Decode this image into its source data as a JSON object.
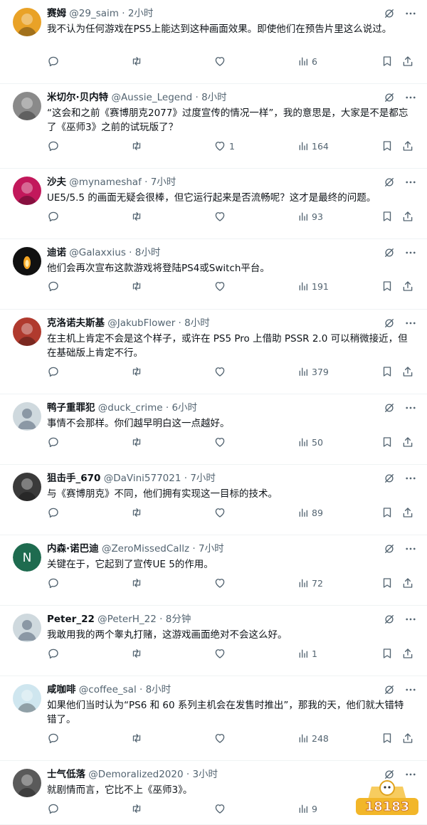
{
  "tweets": [
    {
      "name": "赛姆",
      "handle": "@29_saim",
      "time": "2小时",
      "text": "我不认为任何游戏在PS5上能达到这种画面效果。即使他们在预告片里这么说过。",
      "likes": "",
      "views": "6",
      "avatar_color": "#e9a227"
    },
    {
      "name": "米切尔·贝内特",
      "handle": "@Aussie_Legend",
      "time": "8小时",
      "text": "“这会和之前《赛博朋克2077》过度宣传的情况一样”，我的意思是，大家是不是都忘了《巫师3》之前的试玩版了？",
      "likes": "1",
      "views": "164",
      "avatar_color": "#8a8a8a"
    },
    {
      "name": "沙夫",
      "handle": "@mynameshaf",
      "time": "7小时",
      "text": "UE5/5.5 的画面无疑会很棒，但它运行起来是否流畅呢？这才是最终的问题。",
      "likes": "",
      "views": "93",
      "avatar_color": "#c2185b"
    },
    {
      "name": "迪诺",
      "handle": "@Galaxxius",
      "time": "8小时",
      "text": "他们会再次宣布这款游戏将登陆PS4或Switch平台。",
      "likes": "",
      "views": "191",
      "avatar_color": "#1a1a1a"
    },
    {
      "name": "克洛诺夫斯基",
      "handle": "@JakubFlower",
      "time": "8小时",
      "text": "在主机上肯定不会是这个样子，或许在 PS5 Pro 上借助 PSSR 2.0 可以稍微接近，但在基础版上肯定不行。",
      "likes": "",
      "views": "379",
      "avatar_color": "#b03a2e"
    },
    {
      "name": "鸭子重罪犯",
      "handle": "@duck_crime",
      "time": "6小时",
      "text": "事情不会那样。你们越早明白这一点越好。",
      "likes": "",
      "views": "50",
      "avatar_color": "#c4cfd6"
    },
    {
      "name": "狙击手_670",
      "handle": "@DaVini577021",
      "time": "7小时",
      "text": "与《赛博朋克》不同，他们拥有实现这一目标的技术。",
      "likes": "",
      "views": "89",
      "avatar_color": "#3a3a3a"
    },
    {
      "name": "内森·诺巴迪",
      "handle": "@ZeroMissedCallz",
      "time": "7小时",
      "text": "关键在于，它起到了宣传UE 5的作用。",
      "likes": "",
      "views": "72",
      "avatar_color": "#1e6b4f",
      "avatar_letter": "N"
    },
    {
      "name": "Peter_22",
      "handle": "@PeterH_22",
      "time": "8分钟",
      "text": "我敢用我的两个睾丸打赌，这游戏画面绝对不会这么好。",
      "likes": "",
      "views": "1",
      "avatar_color": "#c4cfd6"
    },
    {
      "name": "咸咖啡",
      "handle": "@coffee_sal",
      "time": "8小时",
      "text": "如果他们当时认为“PS6 和 60 系列主机会在发售时推出”，那我的天，他们就大错特错了。",
      "likes": "",
      "views": "248",
      "avatar_color": "#cfe6ef"
    },
    {
      "name": "士气低落",
      "handle": "@Demoralized2020",
      "time": "3小时",
      "text": "就剧情而言，它比不上《巫师3》。",
      "likes": "",
      "views": "9",
      "avatar_color": "#5a5a5a"
    }
  ],
  "watermark": {
    "text": "18183"
  }
}
